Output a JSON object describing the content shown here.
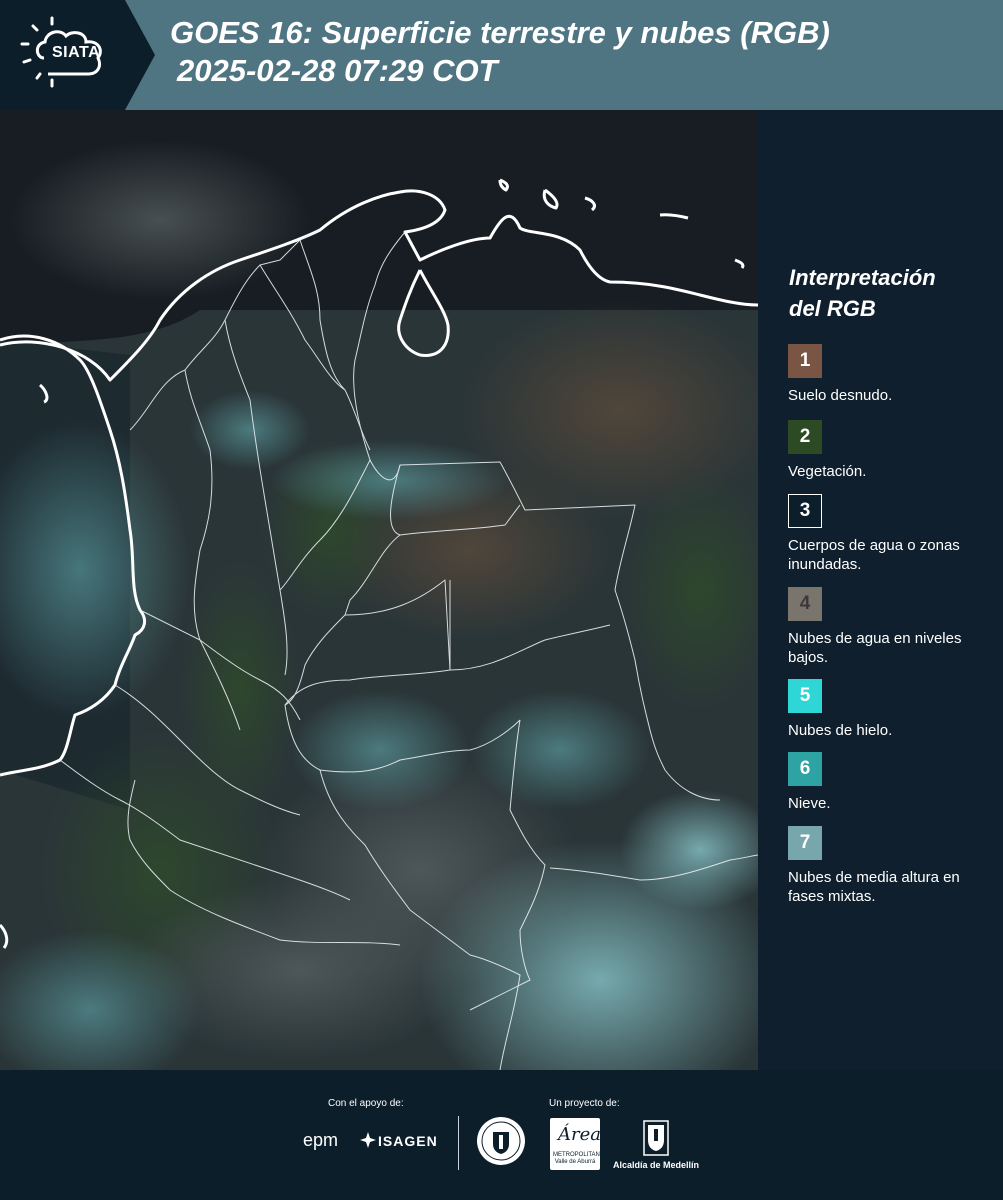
{
  "header": {
    "logo_text": "SIATA",
    "title_line1": "GOES 16: Superficie terrestre y nubes (RGB)",
    "title_line2": "2025-02-28 07:29 COT",
    "background_color": "#4f7583"
  },
  "legend": {
    "title_line1": "Interpretación",
    "title_line2": "del RGB",
    "items": [
      {
        "number": "1",
        "label": "Suelo desnudo.",
        "color": "#7b5543"
      },
      {
        "number": "2",
        "label": "Vegetación.",
        "color": "#2c4a24"
      },
      {
        "number": "3",
        "label": "Cuerpos de agua o zonas inundadas.",
        "color": "#0d1e2b"
      },
      {
        "number": "4",
        "label": "Nubes de agua en niveles bajos.",
        "color": "#7a756c"
      },
      {
        "number": "5",
        "label": "Nubes de hielo.",
        "color": "#2ed6d6"
      },
      {
        "number": "6",
        "label": "Nieve.",
        "color": "#2ea3a3"
      },
      {
        "number": "7",
        "label": "Nubes de media altura en fases mixtas.",
        "color": "#77a7ac"
      }
    ]
  },
  "footer": {
    "support_label": "Con el apoyo de:",
    "project_label": "Un proyecto de:",
    "sponsor1": "epm",
    "sponsor2": "ISAGEN",
    "area_main": "Área",
    "area_sub": "METROPOLITANA Valle de Aburrá",
    "alcaldia": "Alcaldía de Medellín"
  },
  "map": {
    "subject": "GOES-16 RGB satellite composite over Colombia with department borders",
    "icons": [
      "siata-logo-icon",
      "medellin-seal-icon",
      "alcaldia-shield-icon",
      "isagen-star-icon"
    ]
  }
}
